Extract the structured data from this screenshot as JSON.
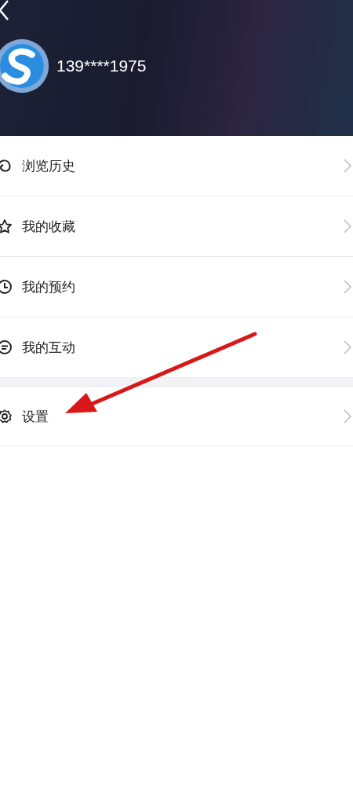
{
  "header": {
    "username": "139****1975"
  },
  "menu_groups": [
    {
      "items": [
        {
          "label": "浏览历史",
          "kind": "history"
        },
        {
          "label": "我的收藏",
          "kind": "favorites"
        },
        {
          "label": "我的预约",
          "kind": "booking"
        },
        {
          "label": "我的互动",
          "kind": "interaction"
        }
      ]
    },
    {
      "items": [
        {
          "label": "设置",
          "kind": "settings"
        }
      ]
    }
  ],
  "annotation": {
    "kind": "arrow"
  }
}
